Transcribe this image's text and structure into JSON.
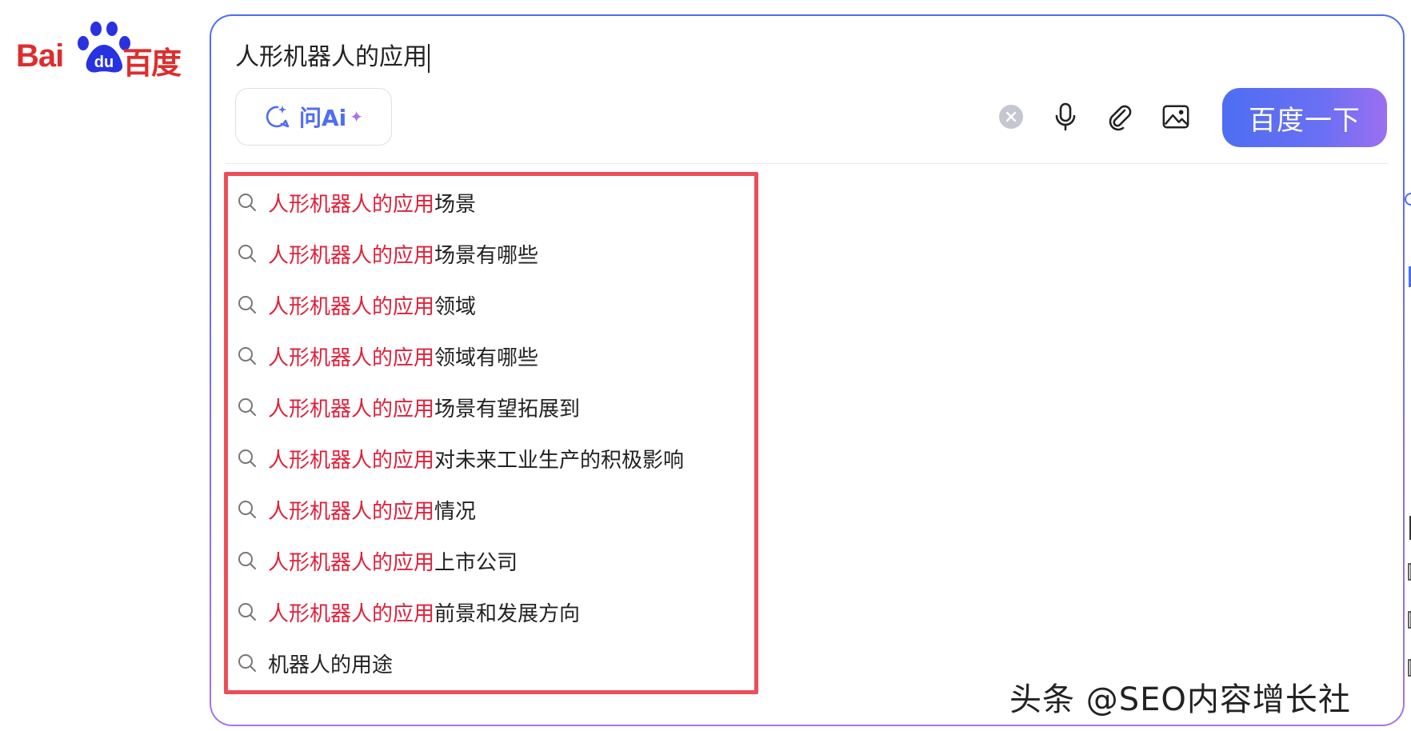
{
  "logo": {
    "text_latin": "Bai",
    "text_paw": "du",
    "text_cn": "百度"
  },
  "search": {
    "query": "人形机器人的应用",
    "ai_button_label": "问Ai",
    "submit_label": "百度一下"
  },
  "icons": {
    "clear": "clear-icon",
    "mic": "microphone-icon",
    "attach": "paperclip-icon",
    "image": "image-search-icon",
    "search": "search-icon"
  },
  "suggestions": [
    {
      "highlight": "人形机器人的应用",
      "rest": "场景"
    },
    {
      "highlight": "人形机器人的应用",
      "rest": "场景有哪些"
    },
    {
      "highlight": "人形机器人的应用",
      "rest": "领域"
    },
    {
      "highlight": "人形机器人的应用",
      "rest": "领域有哪些"
    },
    {
      "highlight": "人形机器人的应用",
      "rest": "场景有望拓展到"
    },
    {
      "highlight": "人形机器人的应用",
      "rest": "对未来工业生产的积极影响"
    },
    {
      "highlight": "人形机器人的应用",
      "rest": "情况"
    },
    {
      "highlight": "人形机器人的应用",
      "rest": "上市公司"
    },
    {
      "highlight": "人形机器人的应用",
      "rest": "前景和发展方向"
    },
    {
      "highlight": "",
      "rest": "机器人的用途"
    }
  ],
  "watermark": "头条 @SEO内容增长社",
  "colors": {
    "brand_blue": "#4e6ef2",
    "brand_red": "#de2d2d",
    "highlight_red": "#e0203a",
    "annotation_border": "#ee4d57",
    "gradient_end": "#a673e9"
  }
}
